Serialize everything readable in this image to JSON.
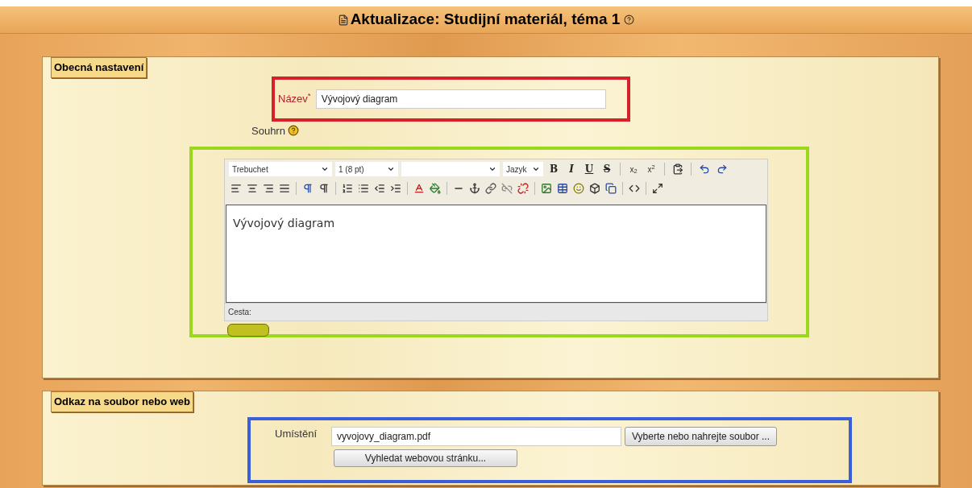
{
  "page_title": "Aktualizace: Studijní materiál, téma 1",
  "general": {
    "legend": "Obecná nastavení",
    "color": "#d8202a",
    "name_label": "Název",
    "required_mark": "*",
    "name_value": "Vývojový diagram",
    "summary_label": "Souhrn",
    "editor": {
      "color": "#9ad81e",
      "font": "Trebuchet",
      "size": "1 (8 pt)",
      "language": "Jazyk",
      "format_buttons": [
        "B",
        "I",
        "U",
        "S"
      ],
      "script_buttons": [
        "x$_{2}$",
        "x$^{2}$"
      ],
      "content": "Vývojový diagram",
      "path_label": "Cesta:"
    }
  },
  "link": {
    "legend": "Odkaz na soubor nebo web",
    "color": "#3a5fd8",
    "location_label": "Umístění",
    "location_value": "vyvojovy_diagram.pdf",
    "buttons": [
      "Vyberte nebo nahrejte soubor ...",
      "Vyhledat webovou stránku..."
    ]
  }
}
